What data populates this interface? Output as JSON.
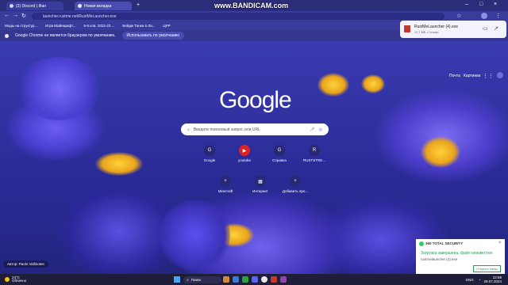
{
  "watermark": "www.BANDICAM.com",
  "tabs": [
    {
      "label": "(2) Discord | Фан"
    },
    {
      "label": "Новая вкладка"
    }
  ],
  "address": {
    "url": "launcher.rustme.net/RustMeLauncher.exe"
  },
  "bookmarks": [
    "Моды на структур...",
    "Игра Майнкрафт...",
    "5-6 кла. 2022-23 ...",
    "Бейдж Танки в Ла...",
    "ЦРР"
  ],
  "infobar": {
    "message": "Google Chrome не является браузером по умолчанию.",
    "button": "Использовать по умолчанию"
  },
  "header_links": {
    "mail": "Почта",
    "images": "Картинки"
  },
  "download": {
    "filename": "RustMeLauncher (4).exe",
    "status": "11,7 МБ • Готово"
  },
  "search": {
    "placeholder": "Введите поисковый запрос или URL"
  },
  "shortcuts_row1": [
    {
      "label": "Google",
      "glyph": "G"
    },
    {
      "label": "youtube",
      "glyph": "▶"
    },
    {
      "label": "Справка",
      "glyph": "G"
    },
    {
      "label": "RUSTSTRE...",
      "glyph": "R"
    }
  ],
  "shortcuts_row2": [
    {
      "label": "Minecraft",
      "glyph": "+"
    },
    {
      "label": "Интернет",
      "glyph": "▦"
    },
    {
      "label": "Добавить ярл...",
      "glyph": "+"
    }
  ],
  "author": "Автор: Paolo Vallinotes",
  "security": {
    "title": "360 TOTAL SECURITY",
    "message": "Загрузка завершена, файл неизвестен",
    "file": "rustmelauncher (4).exe",
    "button": "Открыть папку"
  },
  "taskbar": {
    "weather_temp": "24°C",
    "weather_text": "Облачно",
    "search_placeholder": "Поиск",
    "lang": "ENG",
    "time": "12:59",
    "date": "29.07.2024"
  },
  "colors": {
    "accent": "#3a3c9c",
    "tabbar": "#2b2c7a",
    "taskbar": "#1e1e3a"
  }
}
